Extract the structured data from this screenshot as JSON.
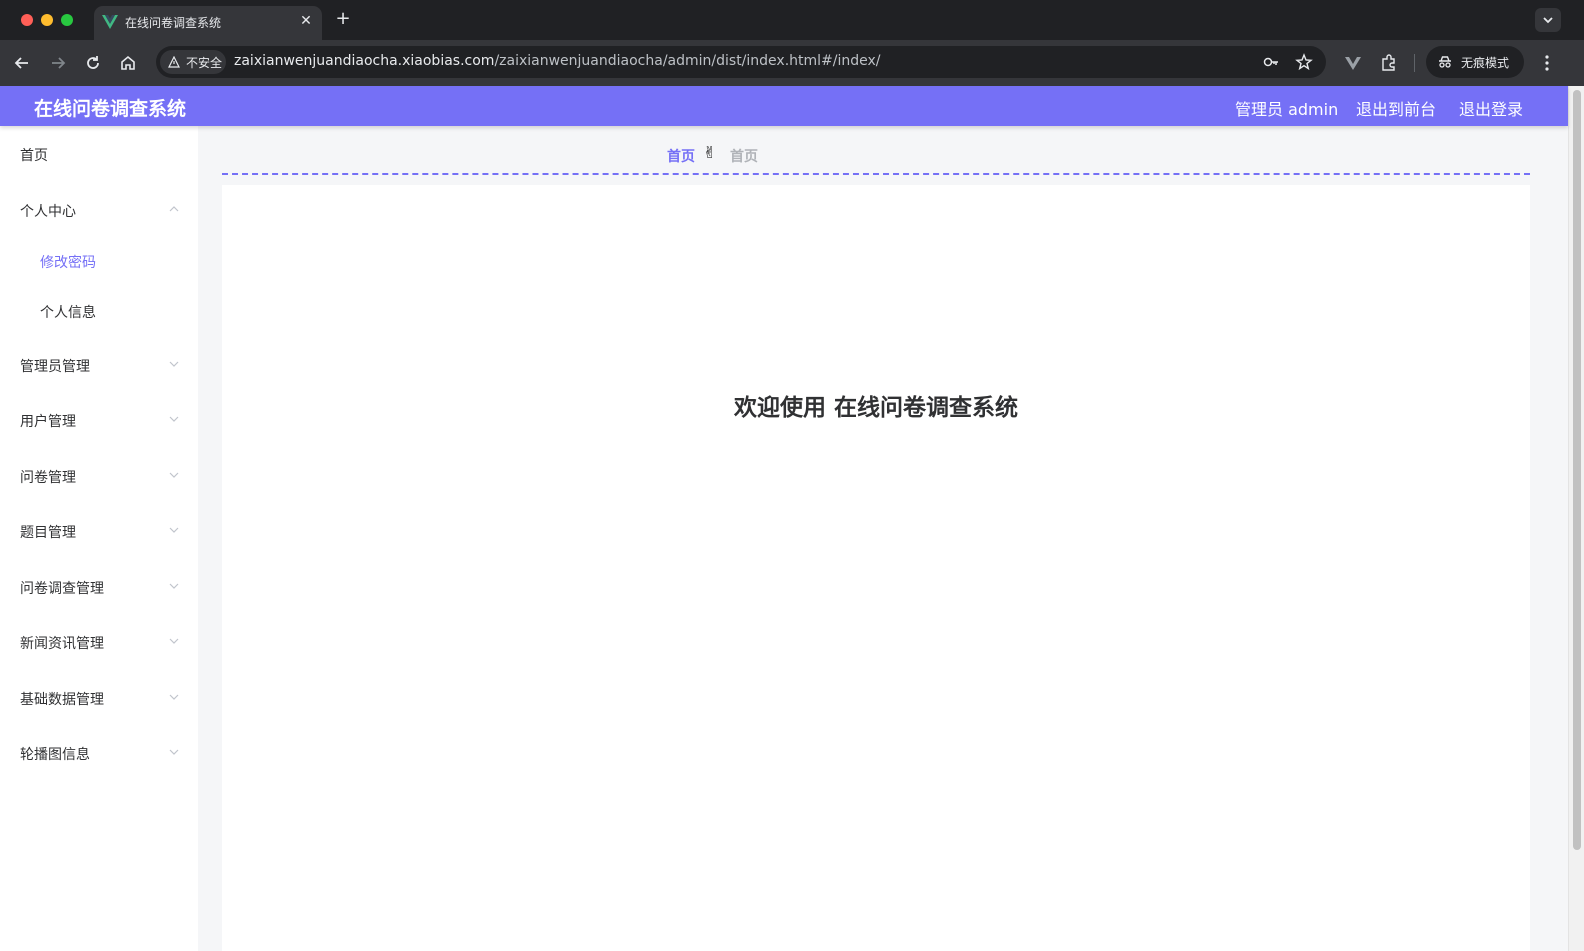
{
  "browser": {
    "tab_title": "在线问卷调查系统",
    "security_label": "不安全",
    "url_host": "zaixianwenjuandiaocha.xiaobias.com",
    "url_path": "/zaixianwenjuandiaocha/admin/dist/index.html#/index/",
    "incognito_label": "无痕模式"
  },
  "header": {
    "title": "在线问卷调查系统",
    "user_label": "管理员 admin",
    "to_frontend": "退出到前台",
    "logout": "退出登录",
    "accent_color": "#7570f6"
  },
  "sidebar": {
    "items": [
      {
        "label": "首页"
      },
      {
        "label": "个人中心",
        "expanded": true,
        "children": [
          {
            "label": "修改密码",
            "active": true
          },
          {
            "label": "个人信息"
          }
        ]
      },
      {
        "label": "管理员管理"
      },
      {
        "label": "用户管理"
      },
      {
        "label": "问卷管理"
      },
      {
        "label": "题目管理"
      },
      {
        "label": "问卷调查管理"
      },
      {
        "label": "新闻资讯管理"
      },
      {
        "label": "基础数据管理"
      },
      {
        "label": "轮播图信息"
      }
    ]
  },
  "breadcrumb": {
    "home": "首页",
    "separator": "✌",
    "current": "首页"
  },
  "main": {
    "welcome": "欢迎使用 在线问卷调查系统"
  }
}
